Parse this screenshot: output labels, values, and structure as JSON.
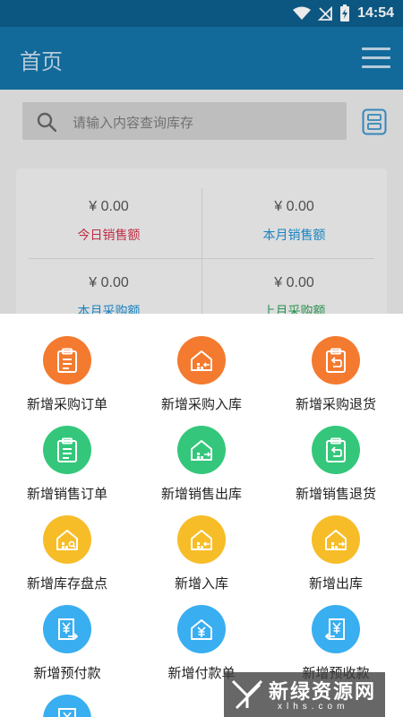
{
  "status_bar": {
    "time": "14:54"
  },
  "header": {
    "title": "首页"
  },
  "search": {
    "placeholder": "请输入内容查询库存"
  },
  "stats": [
    {
      "value": "¥ 0.00",
      "label": "今日销售额",
      "color": "#d0314b"
    },
    {
      "value": "¥ 0.00",
      "label": "本月销售额",
      "color": "#1d8fd0"
    },
    {
      "value": "¥ 0.00",
      "label": "本月采购额",
      "color": "#1d8fd0"
    },
    {
      "value": "¥ 0.00",
      "label": "上月采购额",
      "color": "#2e9e56"
    }
  ],
  "actions": [
    {
      "label": "新增采购订单",
      "icon": "clipboard-icon",
      "color": "#f47a2f"
    },
    {
      "label": "新增采购入库",
      "icon": "warehouse-in-icon",
      "color": "#f47a2f"
    },
    {
      "label": "新增采购退货",
      "icon": "clipboard-return-icon",
      "color": "#f47a2f"
    },
    {
      "label": "新增销售订单",
      "icon": "clipboard-icon",
      "color": "#34c77b"
    },
    {
      "label": "新增销售出库",
      "icon": "warehouse-out-icon",
      "color": "#34c77b"
    },
    {
      "label": "新增销售退货",
      "icon": "clipboard-return-icon",
      "color": "#34c77b"
    },
    {
      "label": "新增库存盘点",
      "icon": "warehouse-check-icon",
      "color": "#f7bd28"
    },
    {
      "label": "新增入库",
      "icon": "warehouse-in-icon",
      "color": "#f7bd28"
    },
    {
      "label": "新增出库",
      "icon": "warehouse-out-icon",
      "color": "#f7bd28"
    },
    {
      "label": "新增预付款",
      "icon": "yen-receipt-icon",
      "color": "#39aef0"
    },
    {
      "label": "新增付款单",
      "icon": "yen-house-icon",
      "color": "#39aef0"
    },
    {
      "label": "新增预收款",
      "icon": "yen-receipt-return-icon",
      "color": "#39aef0"
    },
    {
      "label": "",
      "icon": "receipt-icon",
      "color": "#39aef0"
    }
  ],
  "watermark": {
    "text": "新绿资源网",
    "url_text": "xlhs.com"
  }
}
